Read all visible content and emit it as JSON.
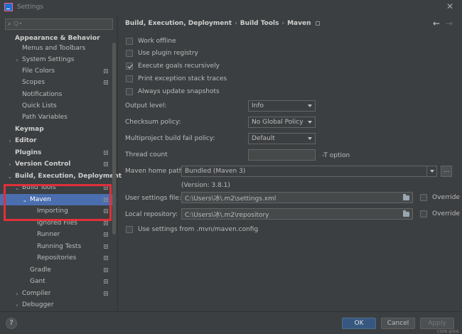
{
  "window": {
    "title": "Settings"
  },
  "sidebar": {
    "search_placeholder": "Q•",
    "items": [
      {
        "label": "Appearance & Behavior"
      },
      {
        "label": "Menus and Toolbars"
      },
      {
        "label": "System Settings"
      },
      {
        "label": "File Colors"
      },
      {
        "label": "Scopes"
      },
      {
        "label": "Notifications"
      },
      {
        "label": "Quick Lists"
      },
      {
        "label": "Path Variables"
      },
      {
        "label": "Keymap"
      },
      {
        "label": "Editor"
      },
      {
        "label": "Plugins"
      },
      {
        "label": "Version Control"
      },
      {
        "label": "Build, Execution, Deployment"
      },
      {
        "label": "Build Tools"
      },
      {
        "label": "Maven"
      },
      {
        "label": "Importing"
      },
      {
        "label": "Ignored Files"
      },
      {
        "label": "Runner"
      },
      {
        "label": "Running Tests"
      },
      {
        "label": "Repositories"
      },
      {
        "label": "Gradle"
      },
      {
        "label": "Gant"
      },
      {
        "label": "Compiler"
      },
      {
        "label": "Debugger"
      }
    ]
  },
  "breadcrumb": {
    "parts": [
      "Build, Execution, Deployment",
      "Build Tools",
      "Maven"
    ],
    "sep": "›"
  },
  "checkboxes": {
    "work_offline": "Work offline",
    "use_plugin_registry": "Use plugin registry",
    "execute_goals_recursively": "Execute goals recursively",
    "print_exception": "Print exception stack traces",
    "always_update": "Always update snapshots"
  },
  "fields": {
    "output_level_label": "Output level:",
    "output_level_value": "Info",
    "checksum_policy_label": "Checksum policy:",
    "checksum_policy_value": "No Global Policy",
    "multiproject_label": "Multiproject build fail policy:",
    "multiproject_value": "Default",
    "thread_count_label": "Thread count",
    "thread_count_value": "",
    "thread_count_hint": "-T option",
    "maven_home_label": "Maven home path:",
    "maven_home_value": "Bundled (Maven 3)",
    "maven_version": "(Version: 3.8.1)",
    "user_settings_label": "User settings file:",
    "user_settings_value": "C:\\Users\\冰\\.m2\\settings.xml",
    "local_repo_label": "Local repository:",
    "local_repo_value": "C:\\Users\\冰\\.m2\\repository",
    "override_label": "Override",
    "use_settings_config": "Use settings from .mvn/maven.config",
    "browse_label": "..."
  },
  "footer": {
    "help": "?",
    "ok": "OK",
    "cancel": "Cancel",
    "apply": "Apply",
    "watermark": "CSDN @冰水"
  }
}
